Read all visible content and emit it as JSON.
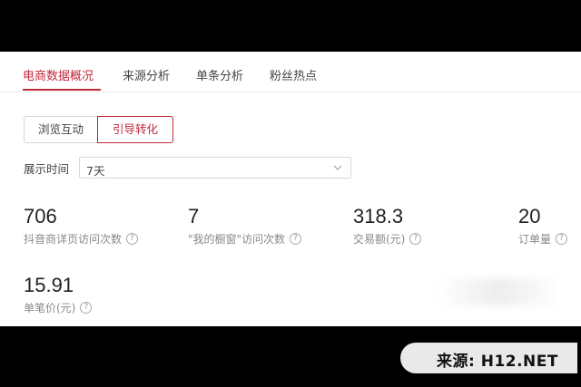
{
  "tabs": [
    {
      "label": "电商数据概况"
    },
    {
      "label": "来源分析"
    },
    {
      "label": "单条分析"
    },
    {
      "label": "粉丝热点"
    }
  ],
  "segment": {
    "option1": "浏览互动",
    "option2": "引导转化",
    "selected": "引导转化"
  },
  "time_range": {
    "label": "展示时间",
    "value": "7天"
  },
  "metrics": [
    {
      "value": "706",
      "label": "抖音商详页访问次数"
    },
    {
      "value": "7",
      "label": "\"我的橱窗\"访问次数"
    },
    {
      "value": "318.3",
      "label": "交易额(元)"
    },
    {
      "value": "20",
      "label": "订单量"
    },
    {
      "value": "15.91",
      "label": "单笔价(元)"
    }
  ],
  "watermark": "来源:  H12.NET",
  "colors": {
    "accent": "#c0283c",
    "text": "#333333",
    "muted": "#888888"
  }
}
